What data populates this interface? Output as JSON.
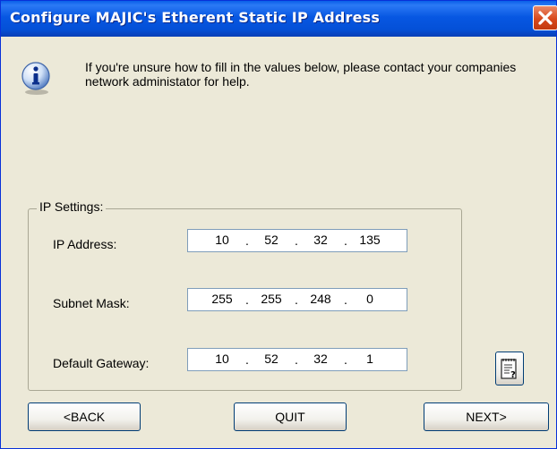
{
  "window": {
    "title": "Configure MAJIC's Etherent Static IP Address",
    "accent_color": "#0054e3",
    "close_color": "#d8491c"
  },
  "info": {
    "icon": "info-icon",
    "message": "If you're unsure how to fill in the values below, please contact your companies network administator for help."
  },
  "ip_settings": {
    "legend": "IP Settings:",
    "fields": [
      {
        "label": "IP Address:",
        "octets": [
          "10",
          "52",
          "32",
          "135"
        ]
      },
      {
        "label": "Subnet Mask:",
        "octets": [
          "255",
          "255",
          "248",
          "0"
        ]
      },
      {
        "label": "Default Gateway:",
        "octets": [
          "10",
          "52",
          "32",
          "1"
        ]
      }
    ],
    "separator": "."
  },
  "buttons": {
    "back": "<BACK",
    "quit": "QUIT",
    "next": "NEXT>",
    "help_icon": "notepad-help-icon"
  }
}
